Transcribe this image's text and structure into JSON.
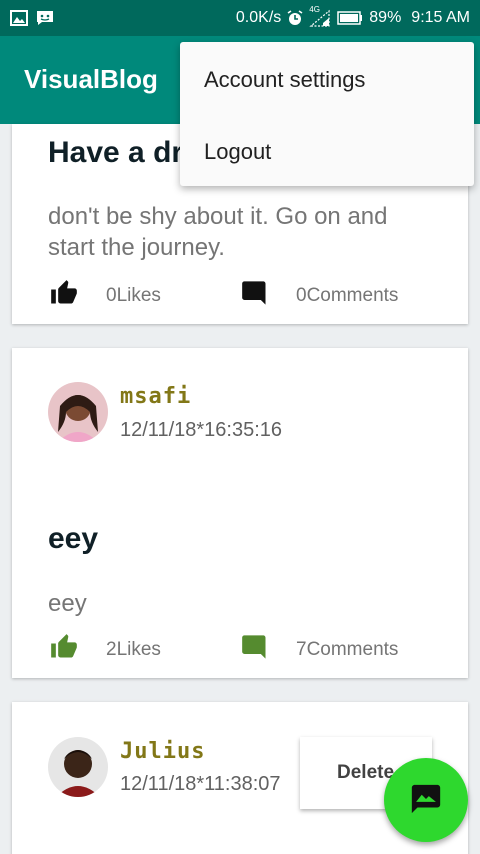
{
  "status_bar": {
    "speed": "0.0K/s",
    "network": "4G",
    "battery": "89%",
    "time": "9:15 AM",
    "icons": [
      "image-notification-icon",
      "message-notification-icon",
      "alarm-icon",
      "signal-icon",
      "battery-icon"
    ]
  },
  "app_bar": {
    "title": "VisualBlog"
  },
  "overflow_menu": {
    "items": [
      "Account settings",
      "Logout"
    ]
  },
  "posts": [
    {
      "title": "Have a dr",
      "description": "don't be shy about it. Go on and start the journey.",
      "likes": "0Likes",
      "comments": "0Comments",
      "liked": false
    },
    {
      "username": "msafi",
      "timestamp": "12/11/18*16:35:16",
      "title": "eey",
      "description": "eey",
      "likes": "2Likes",
      "comments": "7Comments",
      "liked": true
    },
    {
      "username": "Julius",
      "timestamp": "12/11/18*11:38:07",
      "delete_label": "Delete"
    }
  ],
  "colors": {
    "status_bar": "#00695c",
    "app_bar": "#00897b",
    "fab": "#2ed82e",
    "username": "#827717",
    "active_action": "#558b2f"
  },
  "fab": {
    "icon": "add-image-icon"
  }
}
